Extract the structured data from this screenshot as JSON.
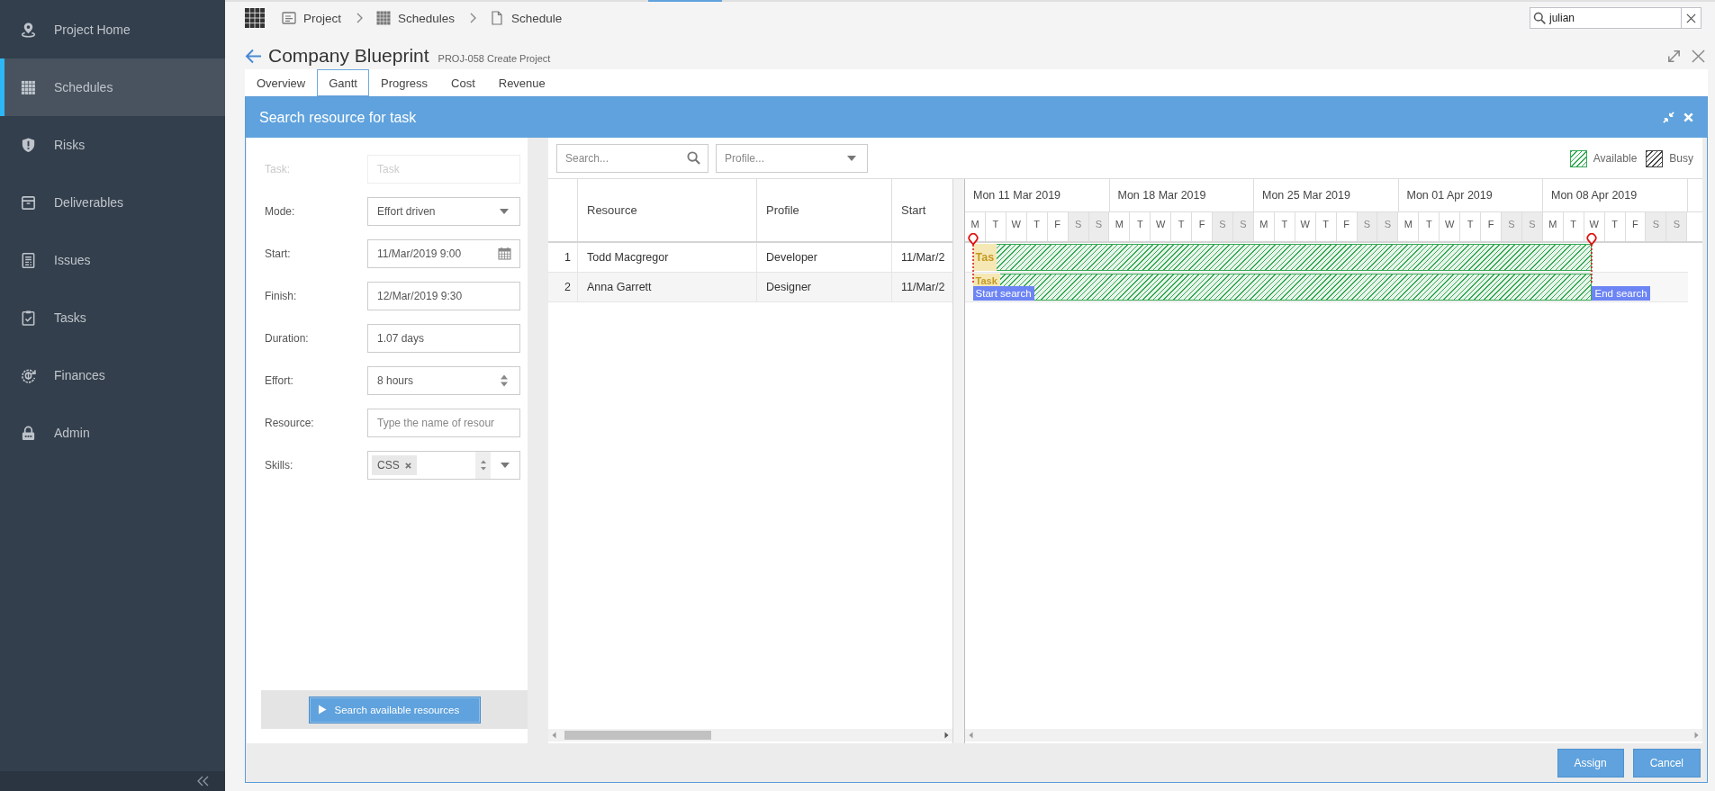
{
  "sidebar": {
    "items": [
      {
        "label": "Project Home",
        "kind": "home",
        "selected": false
      },
      {
        "label": "Schedules",
        "kind": "schedules",
        "selected": true
      },
      {
        "label": "Risks",
        "kind": "risks",
        "selected": false
      },
      {
        "label": "Deliverables",
        "kind": "deliverables",
        "selected": false
      },
      {
        "label": "Issues",
        "kind": "issues",
        "selected": false
      },
      {
        "label": "Tasks",
        "kind": "tasks",
        "selected": false
      },
      {
        "label": "Finances",
        "kind": "finances",
        "selected": false
      },
      {
        "label": "Admin",
        "kind": "admin",
        "selected": false
      }
    ]
  },
  "app_bar": {
    "breadcrumbs": [
      {
        "label": "Project",
        "kind": "project"
      },
      {
        "label": "Schedules",
        "kind": "schedules"
      },
      {
        "label": "Schedule",
        "kind": "document"
      }
    ],
    "search": {
      "value": "julian"
    }
  },
  "page": {
    "title": "Company Blueprint",
    "subtitle": "PROJ-058 Create Project"
  },
  "tabs": [
    {
      "label": "Overview",
      "selected": false
    },
    {
      "label": "Gantt",
      "selected": true
    },
    {
      "label": "Progress",
      "selected": false
    },
    {
      "label": "Cost",
      "selected": false
    },
    {
      "label": "Revenue",
      "selected": false
    }
  ],
  "dialog": {
    "title": "Search resource for task",
    "form": {
      "fields": [
        {
          "label": "Task:",
          "kind": "text",
          "placeholder": "Task",
          "disabled": true
        },
        {
          "label": "Mode:",
          "kind": "select",
          "value": "Effort driven",
          "disabled": false
        },
        {
          "label": "Start:",
          "kind": "date",
          "value": "11/Mar/2019 9:00",
          "disabled": false
        },
        {
          "label": "Finish:",
          "kind": "text",
          "value": "12/Mar/2019 9:30",
          "disabled": false
        },
        {
          "label": "Duration:",
          "kind": "text",
          "value": "1.07 days",
          "disabled": false
        },
        {
          "label": "Effort:",
          "kind": "spinner",
          "value": "8 hours",
          "disabled": false
        },
        {
          "label": "Resource:",
          "kind": "text",
          "placeholder": "Type the name of resour",
          "disabled": false
        },
        {
          "label": "Skills:",
          "kind": "tags",
          "tags": [
            "CSS"
          ],
          "disabled": false
        }
      ],
      "search_button": "Search available resources"
    },
    "toolbar": {
      "search": {
        "placeholder": "Search..."
      },
      "profile": {
        "placeholder": "Profile..."
      },
      "legend": [
        {
          "label": "Available",
          "color": "#35a853"
        },
        {
          "label": "Busy",
          "color": "#444444"
        }
      ]
    },
    "grid": {
      "columns": [
        "Resource",
        "Profile",
        "Start"
      ],
      "rows": [
        {
          "number": "1",
          "resource": "Todd Macgregor",
          "profile": "Developer",
          "start": "11/Mar/2"
        },
        {
          "number": "2",
          "resource": "Anna Garrett",
          "profile": "Designer",
          "start": "11/Mar/2"
        }
      ]
    },
    "gantt": {
      "weeks": [
        {
          "label": "Mon 11 Mar 2019",
          "days": [
            {
              "label": "M",
              "weekend": false
            },
            {
              "label": "T",
              "weekend": false
            },
            {
              "label": "W",
              "weekend": false
            },
            {
              "label": "T",
              "weekend": false
            },
            {
              "label": "F",
              "weekend": false
            },
            {
              "label": "S",
              "weekend": true
            },
            {
              "label": "S",
              "weekend": true
            }
          ]
        },
        {
          "label": "Mon 18 Mar 2019",
          "days": [
            {
              "label": "M",
              "weekend": false
            },
            {
              "label": "T",
              "weekend": false
            },
            {
              "label": "W",
              "weekend": false
            },
            {
              "label": "T",
              "weekend": false
            },
            {
              "label": "F",
              "weekend": false
            },
            {
              "label": "S",
              "weekend": true
            },
            {
              "label": "S",
              "weekend": true
            }
          ]
        },
        {
          "label": "Mon 25 Mar 2019",
          "days": [
            {
              "label": "M",
              "weekend": false
            },
            {
              "label": "T",
              "weekend": false
            },
            {
              "label": "W",
              "weekend": false
            },
            {
              "label": "T",
              "weekend": false
            },
            {
              "label": "F",
              "weekend": false
            },
            {
              "label": "S",
              "weekend": true
            },
            {
              "label": "S",
              "weekend": true
            }
          ]
        },
        {
          "label": "Mon 01 Apr 2019",
          "days": [
            {
              "label": "M",
              "weekend": false
            },
            {
              "label": "T",
              "weekend": false
            },
            {
              "label": "W",
              "weekend": false
            },
            {
              "label": "T",
              "weekend": false
            },
            {
              "label": "F",
              "weekend": false
            },
            {
              "label": "S",
              "weekend": true
            },
            {
              "label": "S",
              "weekend": true
            }
          ]
        },
        {
          "label": "Mon 08 Apr 2019",
          "days": [
            {
              "label": "M",
              "weekend": false
            },
            {
              "label": "T",
              "weekend": false
            },
            {
              "label": "W",
              "weekend": false
            },
            {
              "label": "T",
              "weekend": false
            },
            {
              "label": "F",
              "weekend": false
            },
            {
              "label": "S",
              "weekend": true
            },
            {
              "label": "S",
              "weekend": true
            }
          ]
        }
      ],
      "rows": [
        {
          "task": "Tas",
          "kind": "available"
        },
        {
          "task": "Task",
          "kind": "available"
        }
      ],
      "start_marker": "Start search",
      "end_marker": "End search"
    },
    "buttons": [
      {
        "label": "Assign"
      },
      {
        "label": "Cancel"
      }
    ]
  }
}
